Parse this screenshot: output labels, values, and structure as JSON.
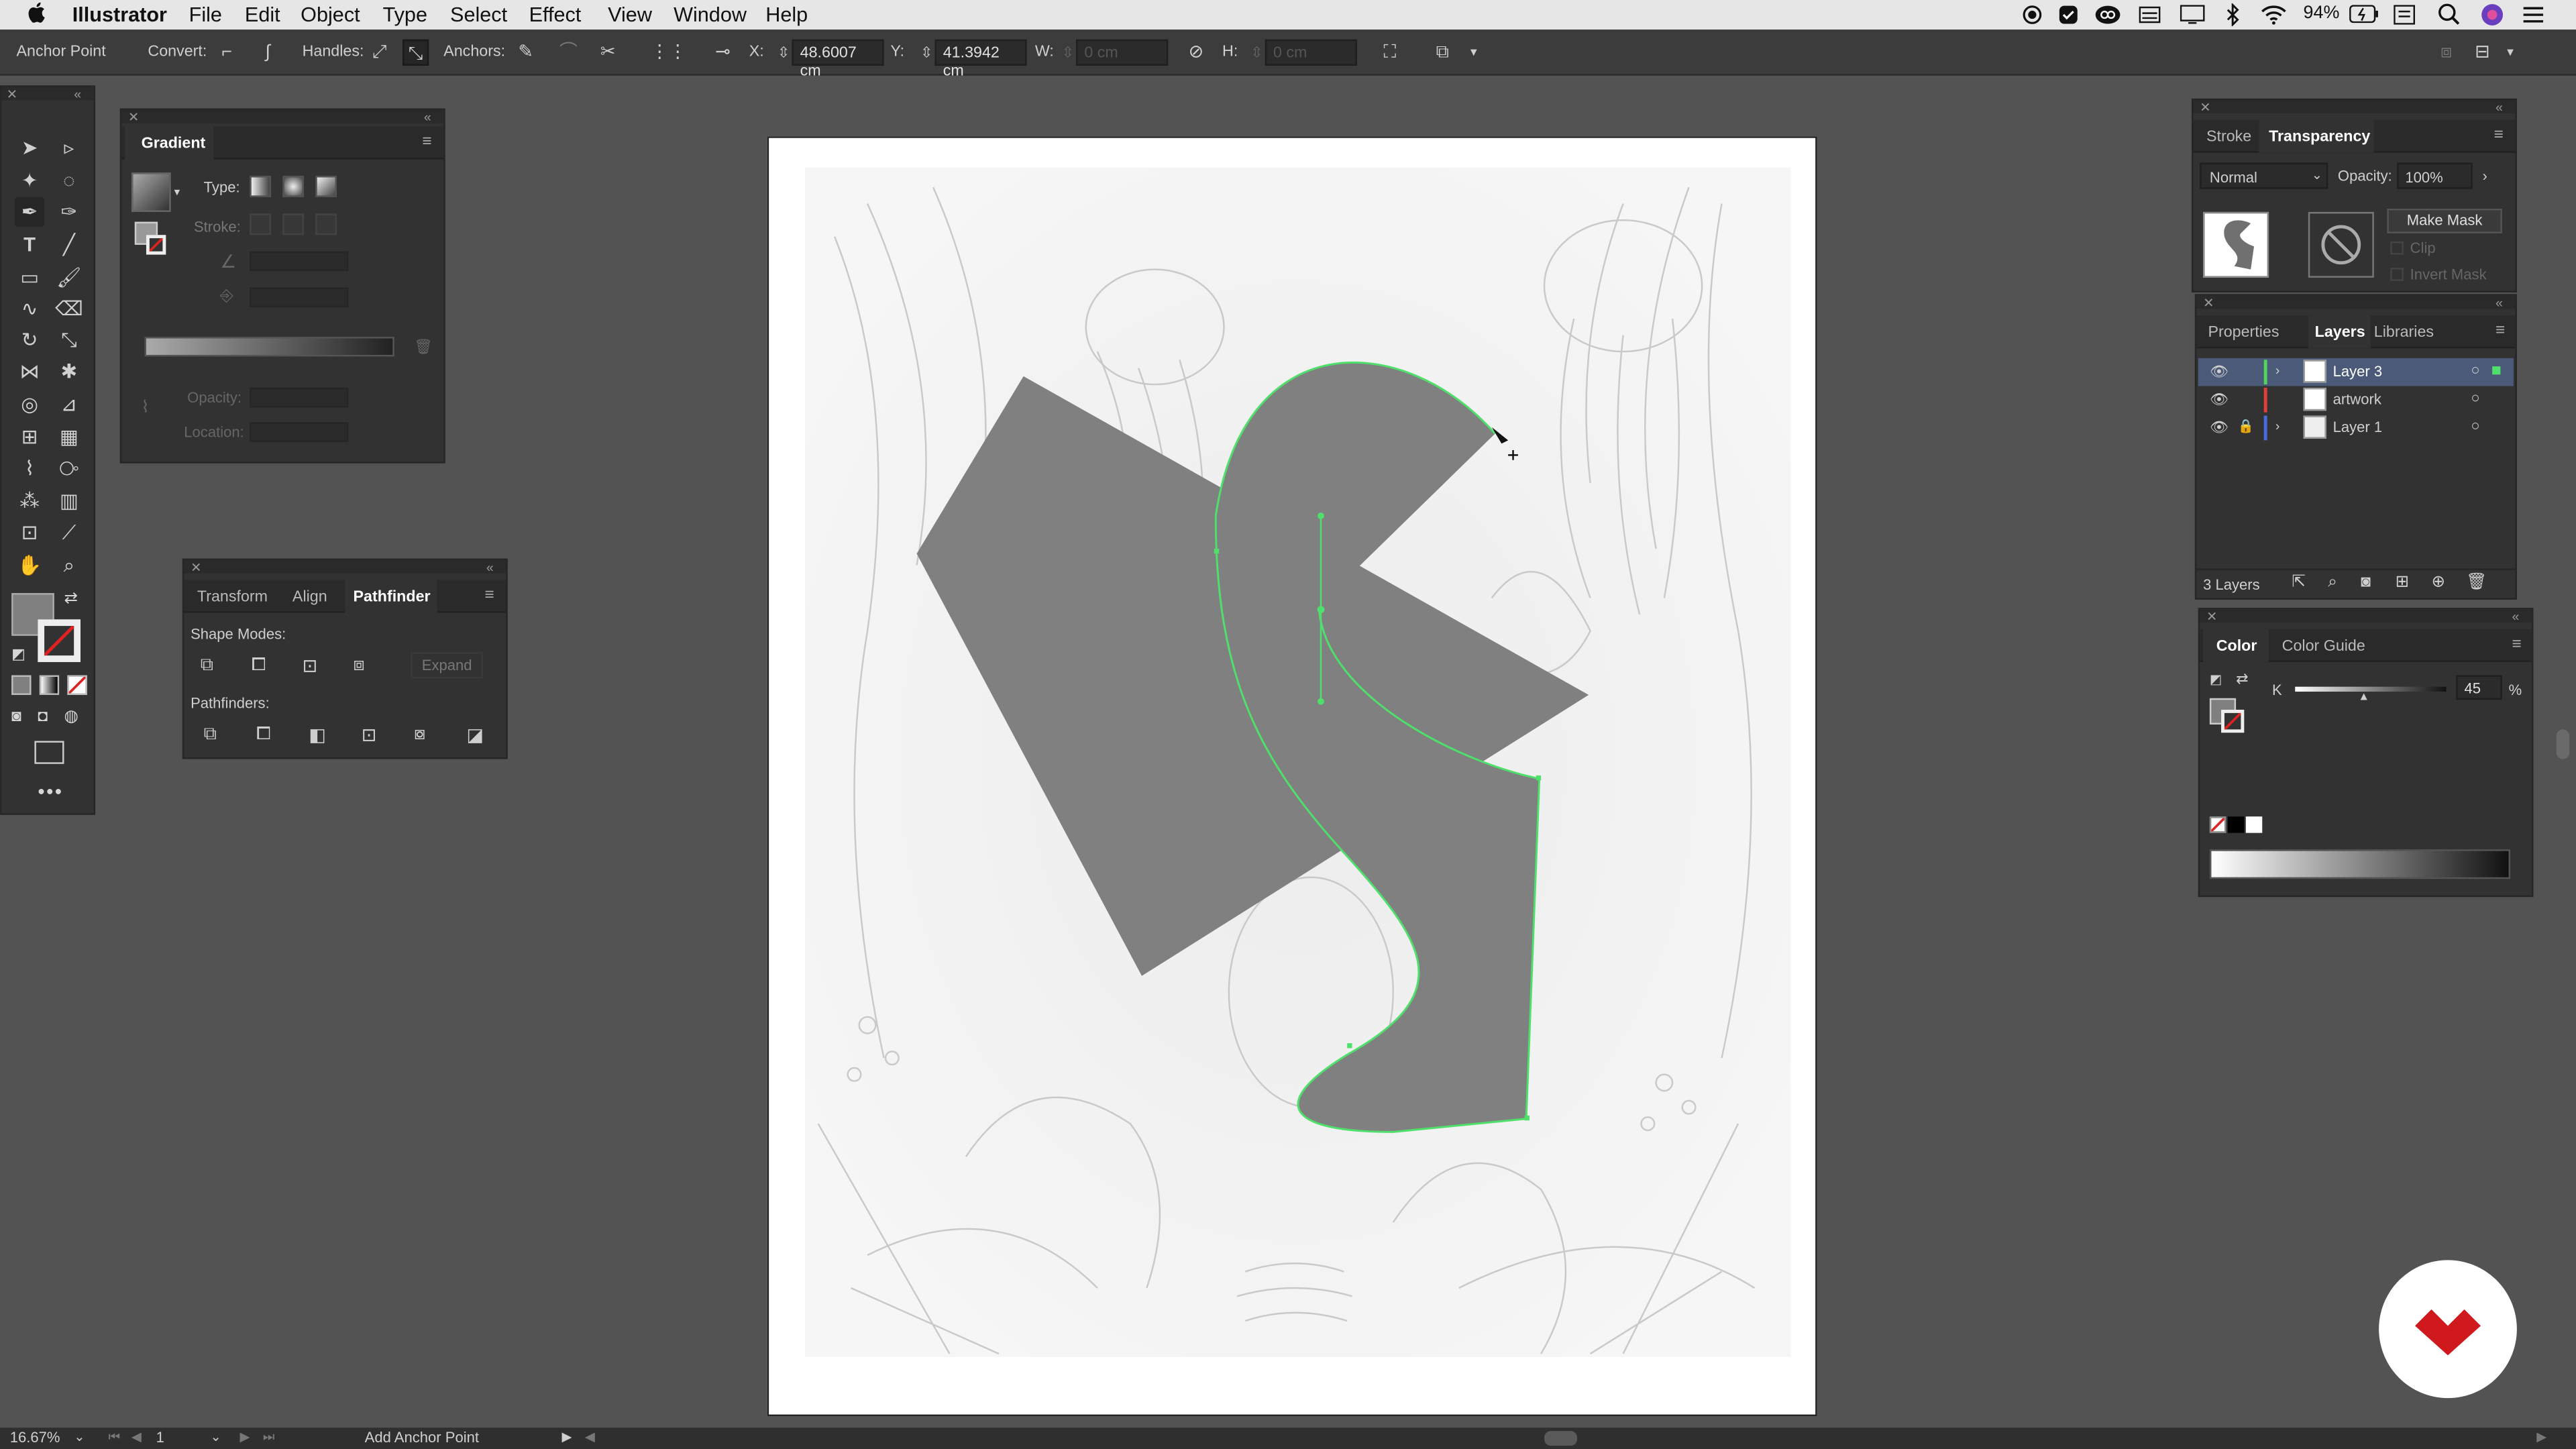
{
  "menubar": {
    "apple": "",
    "app_name": "Illustrator",
    "items": [
      "File",
      "Edit",
      "Object",
      "Type",
      "Select",
      "Effect",
      "View",
      "Window",
      "Help"
    ],
    "battery": "94%"
  },
  "control_bar": {
    "tool_name": "Anchor Point",
    "convert_label": "Convert:",
    "handles_label": "Handles:",
    "anchors_label": "Anchors:",
    "x_label": "X:",
    "x_value": "48.6007 cm",
    "y_label": "Y:",
    "y_value": "41.3942 cm",
    "w_label": "W:",
    "w_value": "0 cm",
    "h_label": "H:",
    "h_value": "0 cm"
  },
  "gradient_panel": {
    "title": "Gradient",
    "type_label": "Type:",
    "stroke_label": "Stroke:",
    "opacity_label": "Opacity:",
    "location_label": "Location:"
  },
  "pathfinder_panel": {
    "tabs": [
      "Transform",
      "Align",
      "Pathfinder"
    ],
    "active_tab": "Pathfinder",
    "shape_modes_label": "Shape Modes:",
    "expand_label": "Expand",
    "pathfinders_label": "Pathfinders:"
  },
  "transparency_panel": {
    "tabs": [
      "Stroke",
      "Transparency"
    ],
    "blend_mode": "Normal",
    "opacity_label": "Opacity:",
    "opacity_value": "100%",
    "make_mask_label": "Make Mask",
    "clip_label": "Clip",
    "invert_mask_label": "Invert Mask"
  },
  "layers_panel": {
    "tabs": [
      "Properties",
      "Layers",
      "Libraries"
    ],
    "active_tab": "Layers",
    "layers": [
      {
        "name": "Layer 3",
        "color": "#4fd65a",
        "selected": true,
        "locked": false,
        "expandable": true
      },
      {
        "name": "artwork",
        "color": "#e0403a",
        "selected": false,
        "locked": false,
        "expandable": false
      },
      {
        "name": "Layer 1",
        "color": "#4a6adf",
        "selected": false,
        "locked": true,
        "expandable": true
      }
    ],
    "count_label": "3 Layers"
  },
  "color_panel": {
    "tabs": [
      "Color",
      "Color Guide"
    ],
    "active_tab": "Color",
    "channel_label": "K",
    "channel_value": "45",
    "unit": "%",
    "k_level_percent": 45
  },
  "statusbar": {
    "zoom": "16.67%",
    "artboard": "1",
    "status_text": "Add Anchor Point"
  },
  "colors": {
    "path_highlight": "#4fe06b",
    "shape_fill": "#808080",
    "brand_badge": "#d0191d"
  }
}
